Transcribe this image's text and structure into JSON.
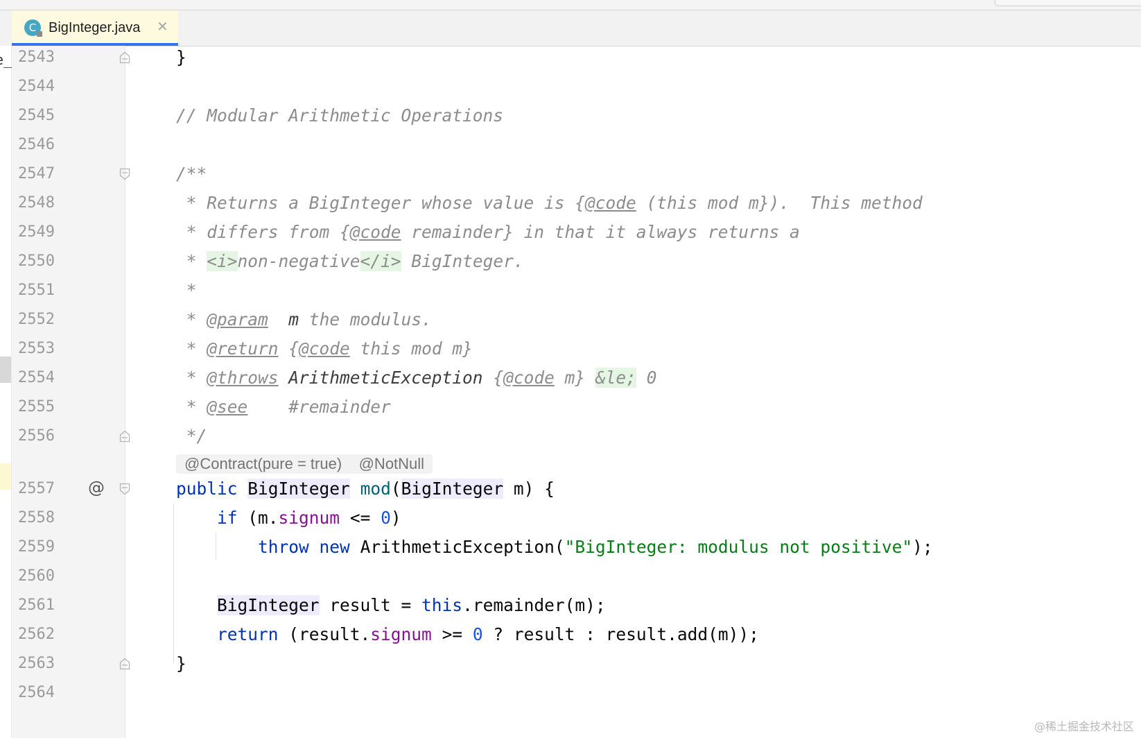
{
  "tab": {
    "label": "BigInteger.java",
    "icon_letter": "C",
    "icon": "java-class-icon",
    "close_icon": "close-icon"
  },
  "left_strip_text": "e_",
  "inlay_hint": "@Contract(pure = true)    @NotNull",
  "gutter_icon": "@",
  "lines": [
    {
      "num": "2543",
      "fold": "end",
      "segs": [
        {
          "t": "}",
          "c": ""
        }
      ]
    },
    {
      "num": "2544",
      "fold": "",
      "segs": []
    },
    {
      "num": "2545",
      "fold": "",
      "segs": [
        {
          "t": "// Modular Arithmetic Operations",
          "c": "cmt"
        }
      ]
    },
    {
      "num": "2546",
      "fold": "",
      "segs": []
    },
    {
      "num": "2547",
      "fold": "start",
      "segs": [
        {
          "t": "/**",
          "c": "cmt"
        }
      ]
    },
    {
      "num": "2548",
      "fold": "",
      "segs": [
        {
          "t": " * Returns a BigInteger whose value is ",
          "c": "cmt"
        },
        {
          "t": "{",
          "c": "cmt"
        },
        {
          "t": "@code",
          "c": "doctag"
        },
        {
          "t": " (this mod m}).  This method",
          "c": "cmt"
        }
      ]
    },
    {
      "num": "2549",
      "fold": "",
      "segs": [
        {
          "t": " * differs from ",
          "c": "cmt"
        },
        {
          "t": "{",
          "c": "cmt"
        },
        {
          "t": "@code",
          "c": "doctag"
        },
        {
          "t": " remainder} in that it always returns a",
          "c": "cmt"
        }
      ]
    },
    {
      "num": "2550",
      "fold": "",
      "segs": [
        {
          "t": " * ",
          "c": "cmt"
        },
        {
          "t": "<i>",
          "c": "htmltag"
        },
        {
          "t": "non-negative",
          "c": "cmt"
        },
        {
          "t": "</i>",
          "c": "htmltag"
        },
        {
          "t": " BigInteger.",
          "c": "cmt"
        }
      ]
    },
    {
      "num": "2551",
      "fold": "",
      "segs": [
        {
          "t": " *",
          "c": "cmt"
        }
      ]
    },
    {
      "num": "2552",
      "fold": "",
      "segs": [
        {
          "t": " * ",
          "c": "cmt"
        },
        {
          "t": "@param",
          "c": "doctag"
        },
        {
          "t": "  ",
          "c": "cmt"
        },
        {
          "t": "m",
          "c": "docarg"
        },
        {
          "t": " the modulus.",
          "c": "cmt"
        }
      ]
    },
    {
      "num": "2553",
      "fold": "",
      "segs": [
        {
          "t": " * ",
          "c": "cmt"
        },
        {
          "t": "@return",
          "c": "doctag"
        },
        {
          "t": " {",
          "c": "cmt"
        },
        {
          "t": "@code",
          "c": "doctag"
        },
        {
          "t": " this mod m}",
          "c": "cmt"
        }
      ]
    },
    {
      "num": "2554",
      "fold": "",
      "segs": [
        {
          "t": " * ",
          "c": "cmt"
        },
        {
          "t": "@throws",
          "c": "doctag"
        },
        {
          "t": " ",
          "c": "cmt"
        },
        {
          "t": "ArithmeticException",
          "c": "docarg"
        },
        {
          "t": " {",
          "c": "cmt"
        },
        {
          "t": "@code",
          "c": "doctag"
        },
        {
          "t": " m} ",
          "c": "cmt"
        },
        {
          "t": "&le;",
          "c": "htmltag"
        },
        {
          "t": " 0",
          "c": "cmt"
        }
      ]
    },
    {
      "num": "2555",
      "fold": "",
      "segs": [
        {
          "t": " * ",
          "c": "cmt"
        },
        {
          "t": "@see",
          "c": "doctag"
        },
        {
          "t": "    #remainder",
          "c": "cmt"
        }
      ]
    },
    {
      "num": "2556",
      "fold": "end",
      "segs": [
        {
          "t": " */",
          "c": "cmt"
        }
      ]
    },
    {
      "num": "2557",
      "fold": "start",
      "segs": [
        {
          "t": "public",
          "c": "kw"
        },
        {
          "t": " ",
          "c": ""
        },
        {
          "t": "BigInteger",
          "c": "hl"
        },
        {
          "t": " ",
          "c": ""
        },
        {
          "t": "mod",
          "c": "mth"
        },
        {
          "t": "(",
          "c": ""
        },
        {
          "t": "BigInteger",
          "c": "hl"
        },
        {
          "t": " m) {",
          "c": ""
        }
      ]
    },
    {
      "num": "2558",
      "fold": "",
      "segs": [
        {
          "t": "    ",
          "c": ""
        },
        {
          "t": "if",
          "c": "kw"
        },
        {
          "t": " (m.",
          "c": ""
        },
        {
          "t": "signum",
          "c": "fld"
        },
        {
          "t": " <= ",
          "c": ""
        },
        {
          "t": "0",
          "c": "num"
        },
        {
          "t": ")",
          "c": ""
        }
      ]
    },
    {
      "num": "2559",
      "fold": "",
      "segs": [
        {
          "t": "        ",
          "c": ""
        },
        {
          "t": "throw",
          "c": "kw"
        },
        {
          "t": " ",
          "c": ""
        },
        {
          "t": "new",
          "c": "kw"
        },
        {
          "t": " ArithmeticException(",
          "c": ""
        },
        {
          "t": "\"BigInteger: modulus not positive\"",
          "c": "str"
        },
        {
          "t": ");",
          "c": ""
        }
      ]
    },
    {
      "num": "2560",
      "fold": "",
      "segs": []
    },
    {
      "num": "2561",
      "fold": "",
      "segs": [
        {
          "t": "    ",
          "c": ""
        },
        {
          "t": "BigInteger",
          "c": "hl"
        },
        {
          "t": " result = ",
          "c": ""
        },
        {
          "t": "this",
          "c": "kw"
        },
        {
          "t": ".remainder(m);",
          "c": ""
        }
      ]
    },
    {
      "num": "2562",
      "fold": "",
      "segs": [
        {
          "t": "    ",
          "c": ""
        },
        {
          "t": "return",
          "c": "kw"
        },
        {
          "t": " (result.",
          "c": ""
        },
        {
          "t": "signum",
          "c": "fld"
        },
        {
          "t": " >= ",
          "c": ""
        },
        {
          "t": "0",
          "c": "num"
        },
        {
          "t": " ? result : result.add(m));",
          "c": ""
        }
      ]
    },
    {
      "num": "2563",
      "fold": "end",
      "segs": [
        {
          "t": "}",
          "c": ""
        }
      ]
    },
    {
      "num": "2564",
      "fold": "",
      "segs": []
    }
  ],
  "watermark": "@稀土掘金技术社区"
}
